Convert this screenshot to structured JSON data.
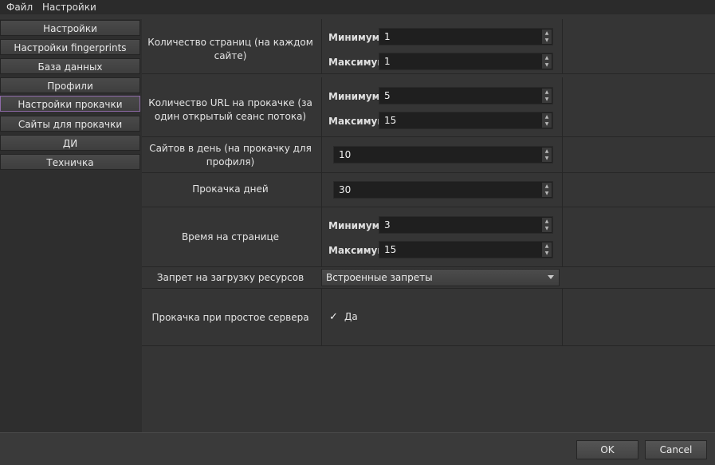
{
  "menu": {
    "file": "Файл",
    "settings": "Настройки"
  },
  "sidebar": {
    "items": [
      {
        "label": "Настройки"
      },
      {
        "label": "Настройки fingerprints"
      },
      {
        "label": "База данных"
      },
      {
        "label": "Профили"
      },
      {
        "label": "Настройки прокачки",
        "active": true
      },
      {
        "label": "Сайты для прокачки"
      },
      {
        "label": "ДИ"
      },
      {
        "label": "Техничка"
      }
    ]
  },
  "form": {
    "min_label": "Минимум",
    "max_label": "Максимум",
    "pages_per_site": {
      "label": "Количество страниц (на каждом сайте)",
      "min": "1",
      "max": "1"
    },
    "urls_per_session": {
      "label": "Количество URL на прокачке (за один открытый сеанс потока)",
      "min": "5",
      "max": "15"
    },
    "sites_per_day": {
      "label": "Сайтов в день (на прокачку для профиля)",
      "value": "10"
    },
    "days": {
      "label": "Прокачка дней",
      "value": "30"
    },
    "time_on_page": {
      "label": "Время на странице",
      "min": "3",
      "max": "15"
    },
    "resource_block": {
      "label": "Запрет на загрузку ресурсов",
      "value": "Встроенные запреты"
    },
    "idle_warmup": {
      "label": "Прокачка при простое сервера",
      "check_label": "Да",
      "checked": true
    }
  },
  "dialog": {
    "ok": "OK",
    "cancel": "Cancel"
  },
  "colors": {
    "active_border": "#8e6aa8",
    "background": "#353535"
  }
}
